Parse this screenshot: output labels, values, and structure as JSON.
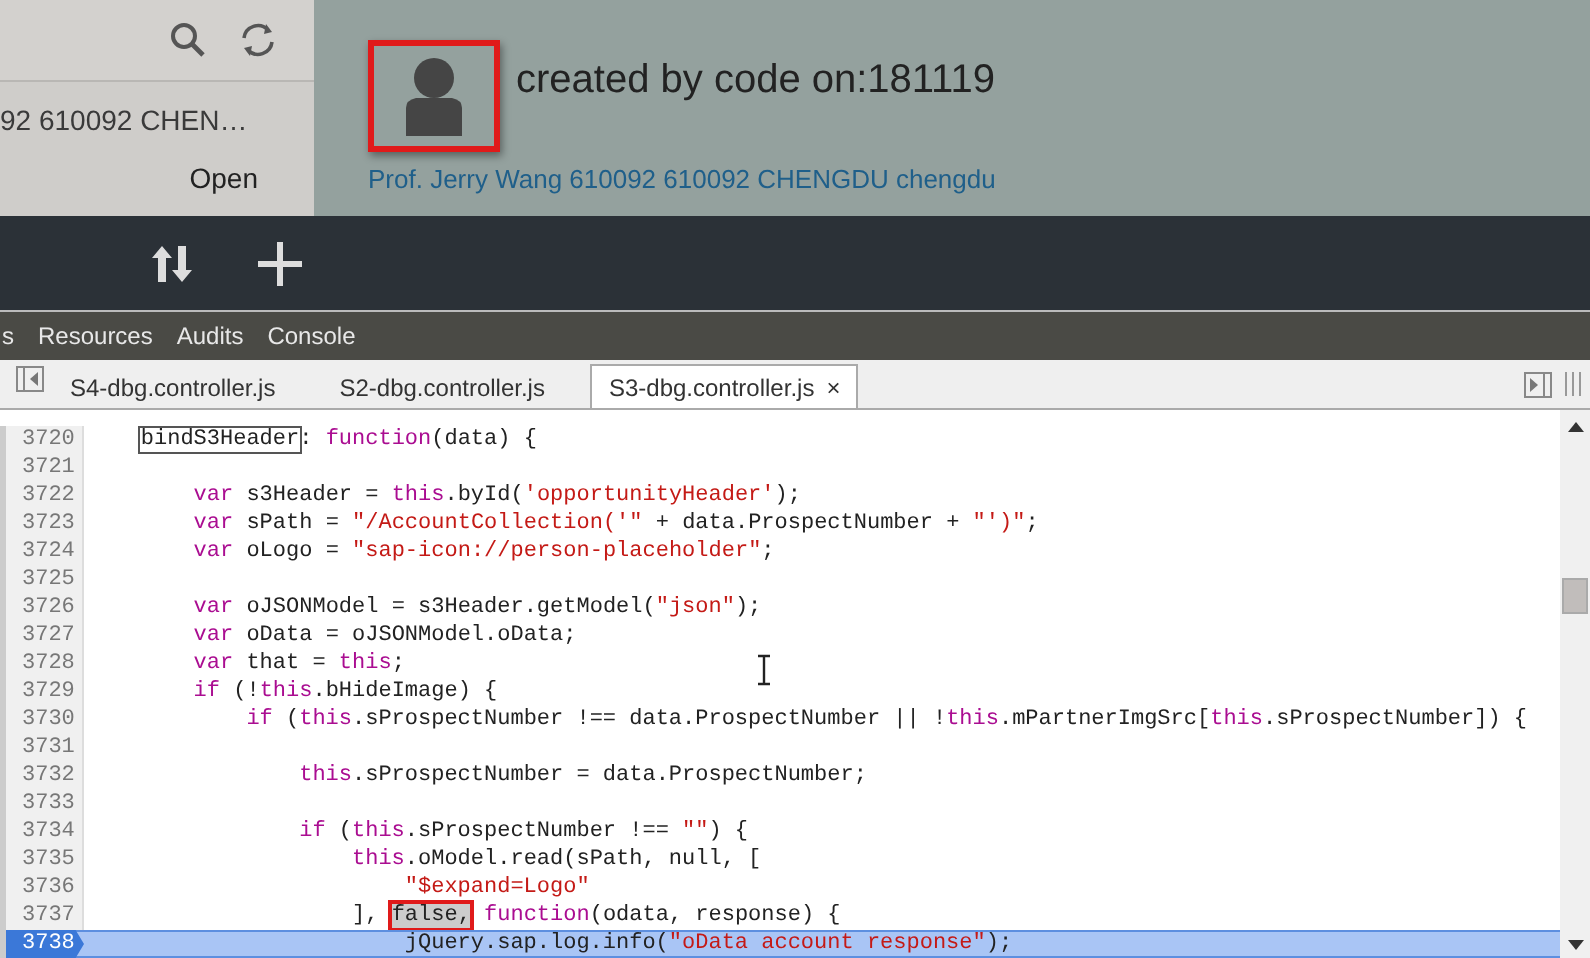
{
  "master": {
    "item_title": "92 610092 CHEN…",
    "item_status": "Open"
  },
  "header": {
    "avatar_highlighted": true,
    "title": "created by code on:181119",
    "contact": "Prof. Jerry Wang 610092 610092 CHENGDU chengdu"
  },
  "devtools_panels": [
    {
      "label": "s",
      "selected": false
    },
    {
      "label": "Resources",
      "selected": false
    },
    {
      "label": "Audits",
      "selected": false
    },
    {
      "label": "Console",
      "selected": false
    }
  ],
  "file_tabs": [
    {
      "label": "S4-dbg.controller.js",
      "selected": false
    },
    {
      "label": "S2-dbg.controller.js",
      "selected": false
    },
    {
      "label": "S3-dbg.controller.js",
      "selected": true,
      "close": "×"
    }
  ],
  "code_lines": [
    {
      "number": "3720",
      "current": false,
      "tokens": [
        {
          "kind": "boxed",
          "text": "bindS3Header"
        },
        {
          "kind": "plain",
          "text": ": "
        },
        {
          "kind": "keyword",
          "text": "function"
        },
        {
          "kind": "plain",
          "text": "(data) {"
        }
      ],
      "children": [
        {
          "number": "3721",
          "current": false
        },
        {
          "number": "3722",
          "current": false,
          "tokens": [
            {
              "kind": "keyword",
              "text": "var"
            },
            {
              "kind": "plain",
              "text": " s3Header = "
            },
            {
              "kind": "keyword",
              "text": "this"
            },
            {
              "kind": "plain",
              "text": ".byId("
            },
            {
              "kind": "string",
              "text": "'opportunityHeader'"
            },
            {
              "kind": "plain",
              "text": ");"
            }
          ]
        },
        {
          "number": "3723",
          "current": false,
          "tokens": [
            {
              "kind": "keyword",
              "text": "var"
            },
            {
              "kind": "plain",
              "text": " sPath = "
            },
            {
              "kind": "string",
              "text": "\"/AccountCollection('\""
            },
            {
              "kind": "plain",
              "text": " + data.ProspectNumber + "
            },
            {
              "kind": "string",
              "text": "\"')\""
            },
            {
              "kind": "plain",
              "text": ";"
            }
          ]
        },
        {
          "number": "3724",
          "current": false,
          "tokens": [
            {
              "kind": "keyword",
              "text": "var"
            },
            {
              "kind": "plain",
              "text": " oLogo = "
            },
            {
              "kind": "string",
              "text": "\"sap-icon://person-placeholder\""
            },
            {
              "kind": "plain",
              "text": ";"
            }
          ]
        },
        {
          "number": "3725",
          "current": false
        },
        {
          "number": "3726",
          "current": false,
          "tokens": [
            {
              "kind": "keyword",
              "text": "var"
            },
            {
              "kind": "plain",
              "text": " oJSONModel = s3Header.getModel("
            },
            {
              "kind": "string",
              "text": "\"json\""
            },
            {
              "kind": "plain",
              "text": ");"
            }
          ]
        },
        {
          "number": "3727",
          "current": false,
          "tokens": [
            {
              "kind": "keyword",
              "text": "var"
            },
            {
              "kind": "plain",
              "text": " oData = oJSONModel.oData;"
            }
          ]
        },
        {
          "number": "3728",
          "current": false,
          "tokens": [
            {
              "kind": "keyword",
              "text": "var"
            },
            {
              "kind": "plain",
              "text": " that = "
            },
            {
              "kind": "keyword",
              "text": "this"
            },
            {
              "kind": "plain",
              "text": ";"
            }
          ]
        },
        {
          "number": "3729",
          "current": false,
          "tokens": [
            {
              "kind": "keyword",
              "text": "if"
            },
            {
              "kind": "plain",
              "text": " (!"
            },
            {
              "kind": "keyword",
              "text": "this"
            },
            {
              "kind": "plain",
              "text": ".bHideImage) {"
            }
          ],
          "children": [
            {
              "number": "3730",
              "current": false,
              "tokens": [
                {
                  "kind": "keyword",
                  "text": "if"
                },
                {
                  "kind": "plain",
                  "text": " ("
                },
                {
                  "kind": "keyword",
                  "text": "this"
                },
                {
                  "kind": "plain",
                  "text": ".sProspectNumber !== data.ProspectNumber || !"
                },
                {
                  "kind": "keyword",
                  "text": "this"
                },
                {
                  "kind": "plain",
                  "text": ".mPartnerImgSrc["
                },
                {
                  "kind": "keyword",
                  "text": "this"
                },
                {
                  "kind": "plain",
                  "text": ".sProspectNumber]) {"
                }
              ],
              "children": [
                {
                  "number": "3731",
                  "current": false
                },
                {
                  "number": "3732",
                  "current": false,
                  "tokens": [
                    {
                      "kind": "keyword",
                      "text": "this"
                    },
                    {
                      "kind": "plain",
                      "text": ".sProspectNumber = data.ProspectNumber;"
                    }
                  ]
                },
                {
                  "number": "3733",
                  "current": false
                },
                {
                  "number": "3734",
                  "current": false,
                  "tokens": [
                    {
                      "kind": "keyword",
                      "text": "if"
                    },
                    {
                      "kind": "plain",
                      "text": " ("
                    },
                    {
                      "kind": "keyword",
                      "text": "this"
                    },
                    {
                      "kind": "plain",
                      "text": ".sProspectNumber !== "
                    },
                    {
                      "kind": "string",
                      "text": "\"\""
                    },
                    {
                      "kind": "plain",
                      "text": ") {"
                    }
                  ],
                  "children": [
                    {
                      "number": "3735",
                      "current": false,
                      "tokens": [
                        {
                          "kind": "keyword",
                          "text": "this"
                        },
                        {
                          "kind": "plain",
                          "text": ".oModel.read(sPath, null, ["
                        }
                      ],
                      "children": [
                        {
                          "number": "3736",
                          "current": false,
                          "tokens": [
                            {
                              "kind": "string",
                              "text": "\"$expand=Logo\""
                            }
                          ]
                        }
                      ]
                    },
                    {
                      "number": "3737",
                      "current": false,
                      "tokens": [
                        {
                          "kind": "plain",
                          "text": "], "
                        },
                        {
                          "kind": "marked",
                          "text": "false,"
                        },
                        {
                          "kind": "keyword",
                          "text": " function"
                        },
                        {
                          "kind": "plain",
                          "text": "(odata, response) {"
                        }
                      ],
                      "children": [
                        {
                          "number": "3738",
                          "current": true,
                          "tokens": [
                            {
                              "kind": "plain",
                              "text": "jQuery.sap.log.info("
                            },
                            {
                              "kind": "string",
                              "text": "\"oData account response\""
                            },
                            {
                              "kind": "plain",
                              "text": ");"
                            }
                          ]
                        }
                      ]
                    }
                  ]
                }
              ]
            }
          ]
        }
      ]
    }
  ]
}
